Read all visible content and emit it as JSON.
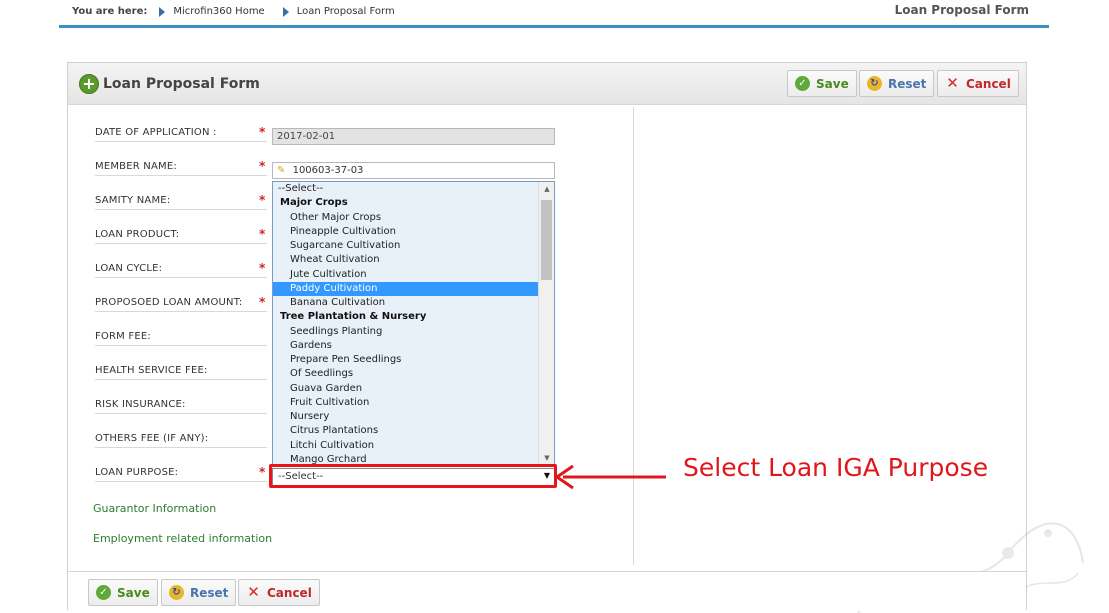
{
  "breadcrumb": {
    "prefix": "You are here:",
    "items": [
      "Microfin360 Home",
      "Loan Proposal Form"
    ],
    "page_title": "Loan Proposal Form"
  },
  "panel": {
    "title": "Loan Proposal Form",
    "buttons": {
      "save": "Save",
      "reset": "Reset",
      "cancel": "Cancel"
    }
  },
  "form": {
    "rows": [
      {
        "label": "DATE OF APPLICATION :",
        "required": true
      },
      {
        "label": "MEMBER NAME:",
        "required": true
      },
      {
        "label": "SAMITY NAME:",
        "required": true
      },
      {
        "label": "LOAN PRODUCT:",
        "required": true
      },
      {
        "label": "LOAN CYCLE:",
        "required": true
      },
      {
        "label": "PROPOSOED LOAN AMOUNT:",
        "required": true
      },
      {
        "label": "FORM FEE:",
        "required": false
      },
      {
        "label": "HEALTH SERVICE FEE:",
        "required": false
      },
      {
        "label": "RISK INSURANCE:",
        "required": false
      },
      {
        "label": "OTHERS FEE (IF ANY):",
        "required": false
      },
      {
        "label": "LOAN PURPOSE:",
        "required": true
      }
    ],
    "date_value": "2017-02-01",
    "member_value": "100603-37-03",
    "purpose_value": "--Select--",
    "guarantor_link": "Guarantor Information",
    "employment_link": "Employment related information"
  },
  "dropdown": {
    "items": [
      {
        "text": "--Select--",
        "kind": "placeholder"
      },
      {
        "text": "Major Crops",
        "kind": "group"
      },
      {
        "text": "Other Major Crops",
        "kind": "option"
      },
      {
        "text": "Pineapple Cultivation",
        "kind": "option"
      },
      {
        "text": "Sugarcane Cultivation",
        "kind": "option"
      },
      {
        "text": "Wheat Cultivation",
        "kind": "option"
      },
      {
        "text": "Jute Cultivation",
        "kind": "option"
      },
      {
        "text": "Paddy Cultivation",
        "kind": "option",
        "selected": true
      },
      {
        "text": "Banana Cultivation",
        "kind": "option"
      },
      {
        "text": "Tree Plantation & Nursery",
        "kind": "group"
      },
      {
        "text": "Seedlings Planting",
        "kind": "option"
      },
      {
        "text": "Gardens",
        "kind": "option"
      },
      {
        "text": "Prepare Pen Seedlings",
        "kind": "option"
      },
      {
        "text": "Of Seedlings",
        "kind": "option"
      },
      {
        "text": "Guava Garden",
        "kind": "option"
      },
      {
        "text": "Fruit Cultivation",
        "kind": "option"
      },
      {
        "text": "Nursery",
        "kind": "option"
      },
      {
        "text": "Citrus Plantations",
        "kind": "option"
      },
      {
        "text": "Litchi Cultivation",
        "kind": "option"
      },
      {
        "text": "Mango Grchard",
        "kind": "option"
      }
    ]
  },
  "annotation": {
    "text": "Select Loan IGA Purpose",
    "color": "#e0161b"
  },
  "colors": {
    "accent_blue": "#3d8fbf",
    "link_green": "#2e7d2e",
    "selection": "#3399ff"
  }
}
